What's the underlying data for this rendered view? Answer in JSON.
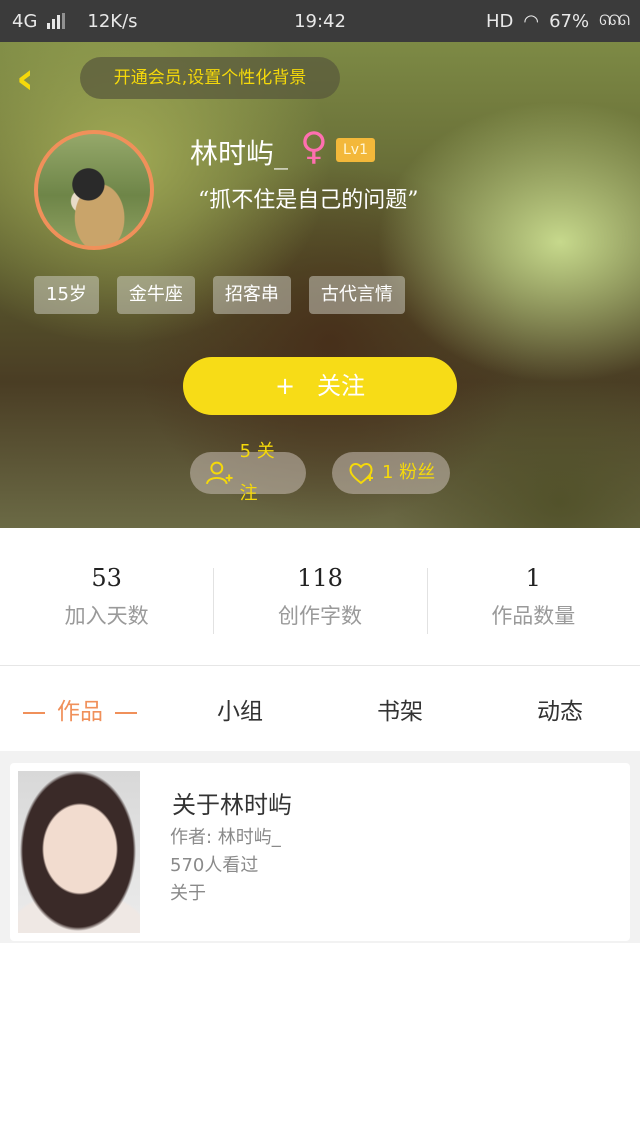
{
  "status_bar": {
    "network": "4G",
    "speed": "12K/s",
    "time": "19:42",
    "hd": "HD",
    "battery": "67%"
  },
  "header": {
    "vip_banner": "开通会员,设置个性化背景",
    "username": "林时屿_",
    "gender_symbol": "♀",
    "level": "Lv1",
    "signature": "“抓不住是自己的问题”",
    "tags": [
      "15岁",
      "金牛座",
      "招客串",
      "古代言情"
    ],
    "follow_button": {
      "icon": "+",
      "label": "关注"
    },
    "following_label": "5 关注",
    "fans_label": "1 粉丝"
  },
  "stats": [
    {
      "value": "53",
      "label": "加入天数"
    },
    {
      "value": "118",
      "label": "创作字数"
    },
    {
      "value": "1",
      "label": "作品数量"
    }
  ],
  "tabs": [
    "作品",
    "小组",
    "书架",
    "动态"
  ],
  "active_tab": "作品",
  "books": [
    {
      "title": "关于林时屿",
      "author": "作者: 林时屿_",
      "views": "570人看过",
      "description": "关于"
    }
  ],
  "colors": {
    "accent_yellow": "#f7dc17",
    "accent_orange": "#f0905a",
    "level_badge": "#f3b83a",
    "gender_pink": "#ff6fb0"
  },
  "icons": {
    "back": "chevron-left-icon",
    "gender": "female-icon",
    "following": "user-plus-icon",
    "fans": "heart-plus-icon"
  }
}
